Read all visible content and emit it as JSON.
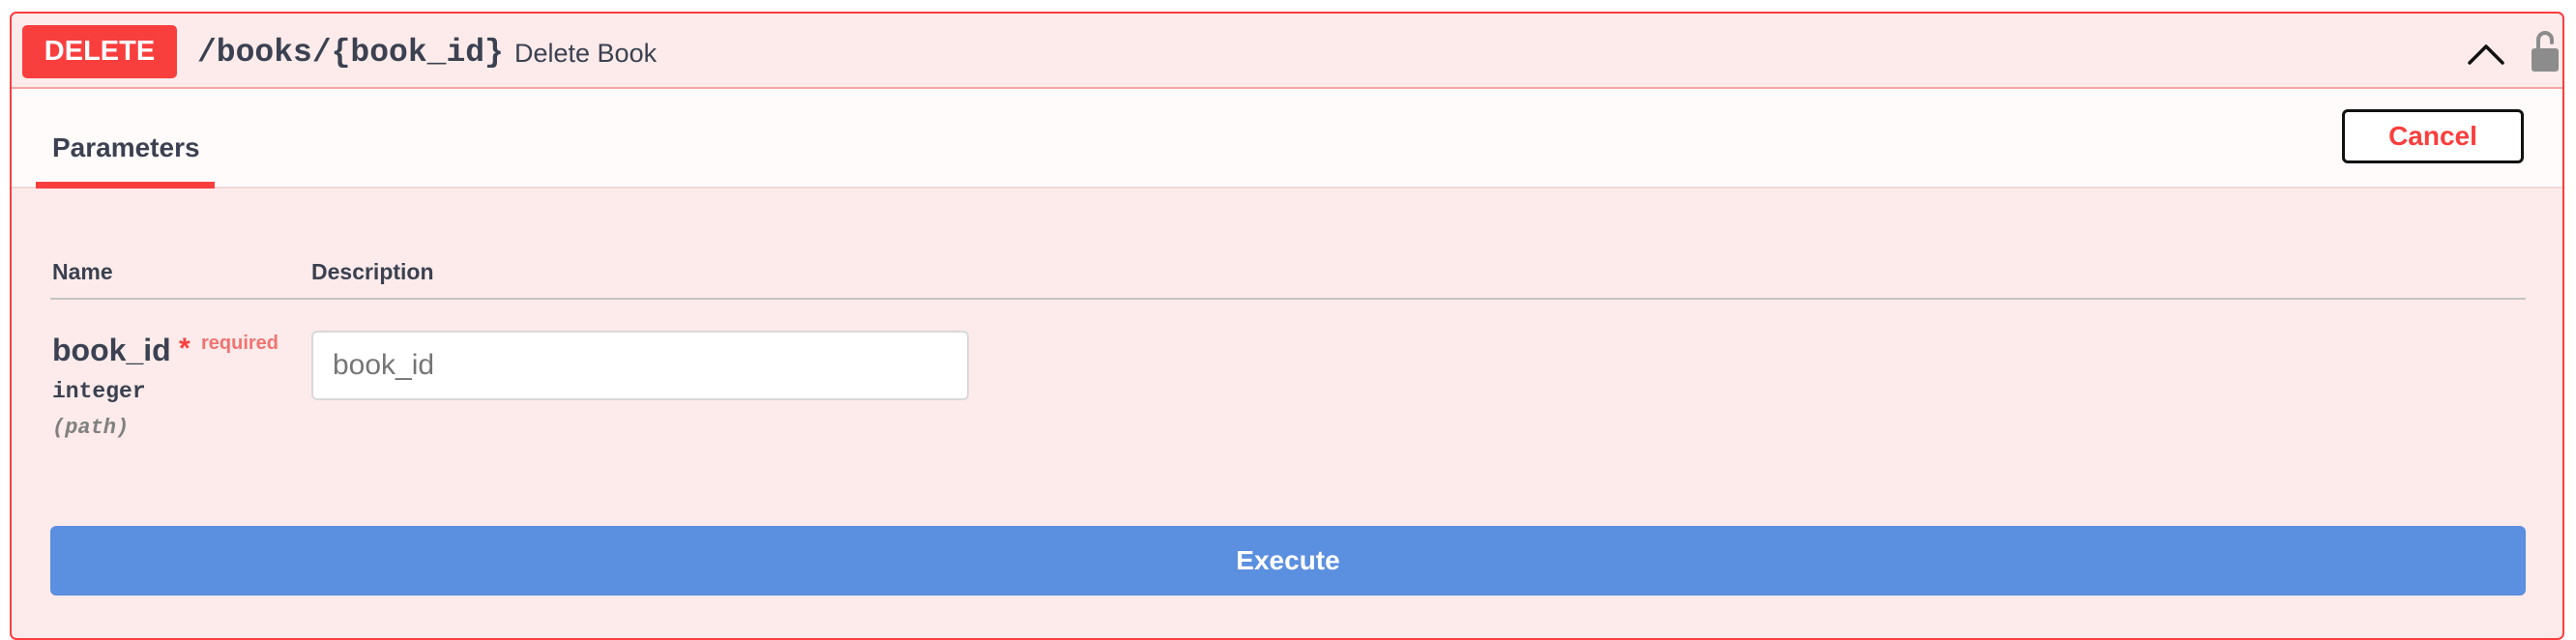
{
  "operation": {
    "method": "DELETE",
    "path": "/books/{book_id}",
    "summary": "Delete Book"
  },
  "icons": {
    "collapse": "chevron-up-icon",
    "auth": "unlocked-padlock-icon"
  },
  "tabs": {
    "parameters": "Parameters",
    "cancel_label": "Cancel"
  },
  "table": {
    "col_name": "Name",
    "col_description": "Description"
  },
  "parameter": {
    "name": "book_id",
    "required_mark": "*",
    "required_text": "required",
    "type": "integer",
    "in": "(path)",
    "value": "",
    "placeholder": "book_id"
  },
  "execute_label": "Execute",
  "colors": {
    "method": "#f93e3e",
    "background": "#fcebea",
    "execute": "#5b8fdf"
  }
}
